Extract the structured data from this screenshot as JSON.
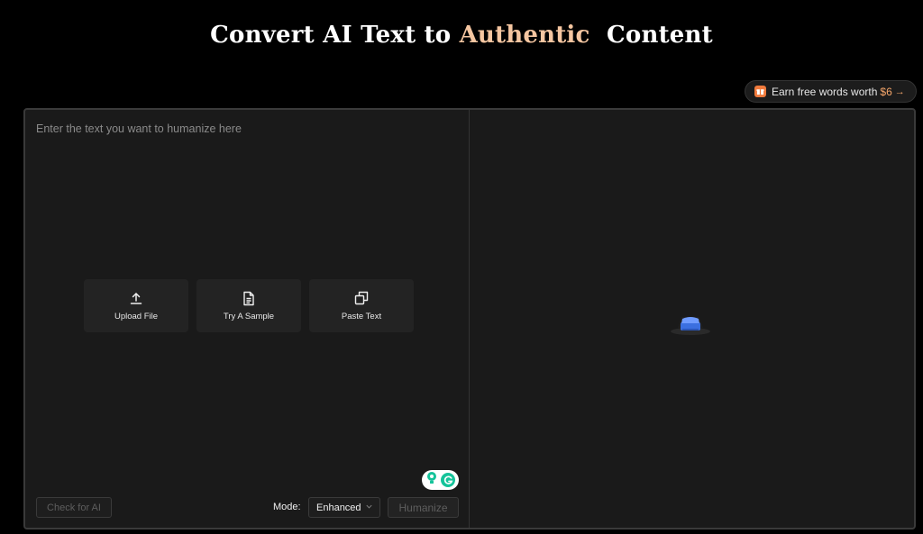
{
  "hero": {
    "title_part1": "Convert AI Text to",
    "title_accent": "Authentic",
    "title_part2": "Content",
    "accent_color": "#f5c6a1"
  },
  "earn_badge": {
    "label": "Earn free words worth",
    "amount": "$6",
    "arrow": "→",
    "icon": "gift-icon",
    "accent_color": "#f5a66a"
  },
  "editor": {
    "placeholder": "Enter the text you want to humanize here",
    "actions": [
      {
        "label": "Upload File",
        "icon": "upload-icon"
      },
      {
        "label": "Try A Sample",
        "icon": "document-icon"
      },
      {
        "label": "Paste Text",
        "icon": "copy-icon"
      }
    ],
    "bottom": {
      "check_ai_label": "Check for AI",
      "mode_label": "Mode:",
      "mode_value": "Enhanced",
      "humanize_label": "Humanize"
    }
  },
  "output": {
    "icon": "empty-box-icon"
  },
  "colors": {
    "background": "#000000",
    "panel": "#1a1a1a",
    "card": "#232323",
    "grammarly": "#15c39a"
  }
}
